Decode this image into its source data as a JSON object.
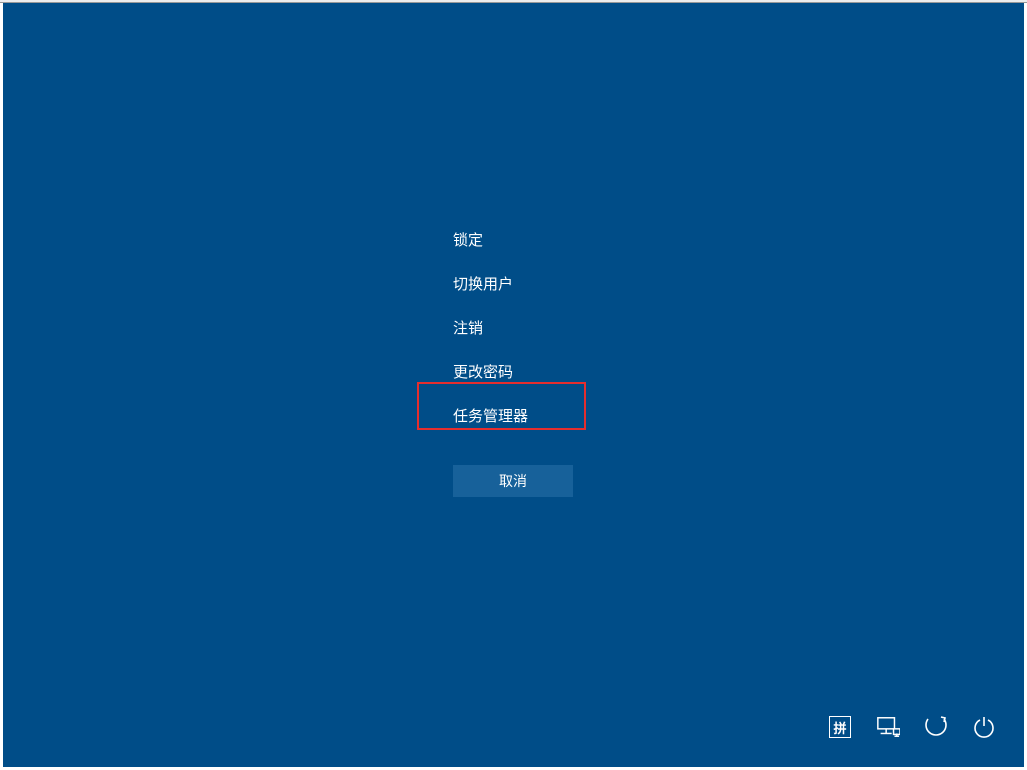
{
  "menu": {
    "items": [
      {
        "label": "锁定"
      },
      {
        "label": "切换用户"
      },
      {
        "label": "注销"
      },
      {
        "label": "更改密码"
      },
      {
        "label": "任务管理器"
      }
    ]
  },
  "buttons": {
    "cancel": "取消"
  },
  "tray": {
    "ime": "拼"
  },
  "colors": {
    "background": "#004D88",
    "highlight": "#E52E2E",
    "cancel_bg": "#17619A"
  }
}
